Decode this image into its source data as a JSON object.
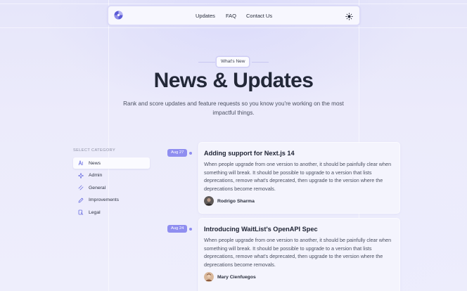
{
  "nav": {
    "links": [
      "Updates",
      "FAQ",
      "Contact Us"
    ],
    "logo_icon": "logo-icon",
    "theme_icon": "sun-icon"
  },
  "hero": {
    "badge": "What's New",
    "title": "News & Updates",
    "subtitle": "Rank and score updates and feature requests so you know you're working on the most impactful things."
  },
  "sidebar": {
    "heading": "SELECT CATEGORY",
    "items": [
      {
        "label": "News",
        "icon": "news-icon",
        "active": true
      },
      {
        "label": "Admin",
        "icon": "sparkle-icon",
        "active": false
      },
      {
        "label": "General",
        "icon": "slash-icon",
        "active": false
      },
      {
        "label": "Improvements",
        "icon": "pencil-icon",
        "active": false
      },
      {
        "label": "Legal",
        "icon": "legal-icon",
        "active": false
      }
    ]
  },
  "posts": [
    {
      "date": "Aug 27",
      "title": "Adding support for Next.js 14",
      "body": "When people upgrade from one version to another, it should be painfully clear when something will break. It should be possible to upgrade to a version that lists deprecations, remove what's deprecated, then upgrade to the version where the deprecations become removals.",
      "author": "Rodrigo Sharma"
    },
    {
      "date": "Aug 24",
      "title": "Introducing WaitList's OpenAPI Spec",
      "body": "When people upgrade from one version to another, it should be painfully clear when something will break. It should be possible to upgrade to a version that lists deprecations, remove what's deprecated, then upgrade to the version where the deprecations become removals.",
      "author": "Mary Cienfuegos"
    }
  ],
  "colors": {
    "accent": "#8f8ef0",
    "text": "#232838",
    "background": "#e9e9fb"
  }
}
